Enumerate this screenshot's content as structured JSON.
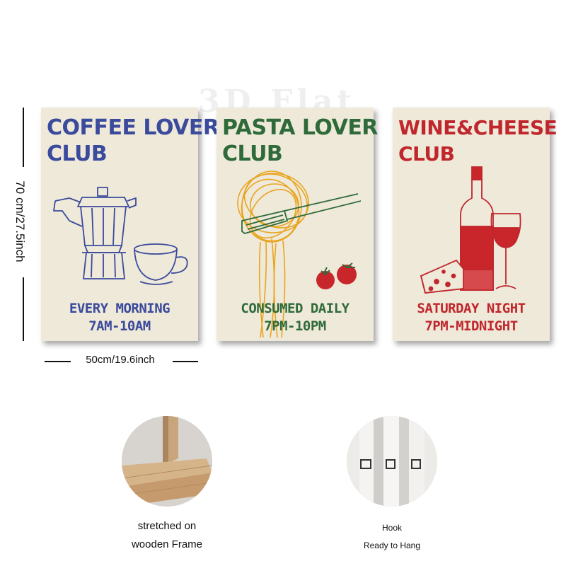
{
  "watermark": "3D Flat",
  "posters": [
    {
      "title_line1": "COFFEE LOVER",
      "title_line2": "CLUB",
      "sub_line1": "EVERY MORNING",
      "sub_line2": "7AM-10AM",
      "color": "#3a4a9c",
      "illustration": "moka-pot-and-cup"
    },
    {
      "title_line1": "PASTA LOVER",
      "title_line2": "CLUB",
      "sub_line1": "CONSUMED DAILY",
      "sub_line2": "7PM-10PM",
      "color": "#2f6b3a",
      "illustration": "spaghetti-fork-tomatoes"
    },
    {
      "title_line1": "WINE&CHEESE",
      "title_line2": "CLUB",
      "sub_line1": "SATURDAY NIGHT",
      "sub_line2": "7PM-MIDNIGHT",
      "color": "#c0272d",
      "illustration": "wine-bottle-glass-cheese"
    }
  ],
  "dimensions": {
    "height_label": "70 cm/27.5inch",
    "width_label": "50cm/19.6inch"
  },
  "features": [
    {
      "caption_line1": "stretched on",
      "caption_line2": "wooden Frame",
      "icon": "wooden-frame-photo"
    },
    {
      "caption_line1": "Hook",
      "caption_line2": "Ready to Hang",
      "icon": "hook-photo"
    }
  ]
}
